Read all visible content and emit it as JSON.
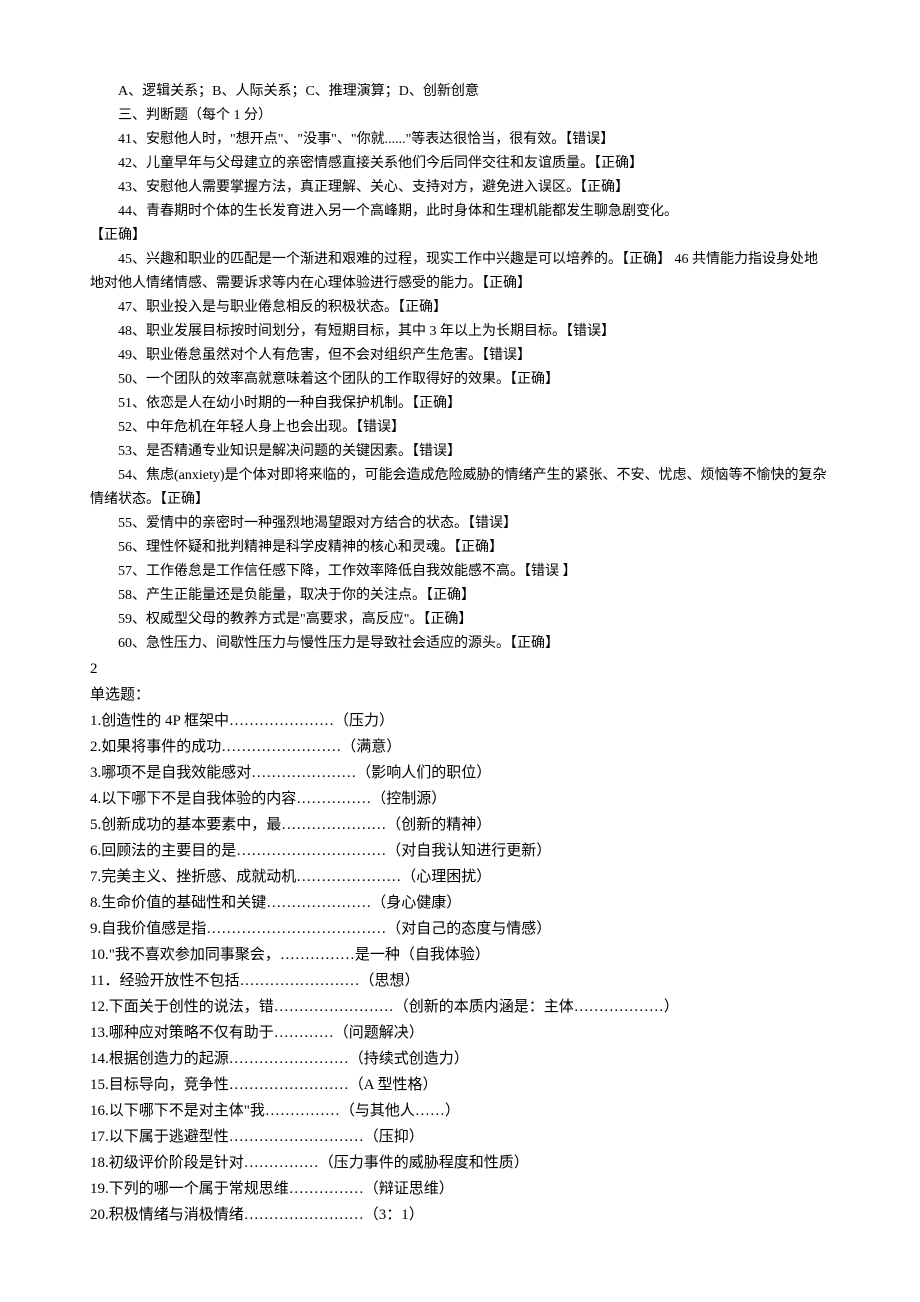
{
  "top": {
    "options": "A、逻辑关系；B、人际关系；C、推理演算；D、创新创意",
    "section_heading": "三、判断题（每个 1 分）",
    "items": [
      "41、安慰他人时，\"想开点\"、\"没事\"、\"你就......\"等表达很恰当，很有效。【错误】",
      "42、儿童早年与父母建立的亲密情感直接关系他们今后同伴交往和友谊质量。【正确】",
      "43、安慰他人需要掌握方法，真正理解、关心、支持对方，避免进入误区。【正确】",
      "44、青春期时个体的生长发育进入另一个高峰期，此时身体和生理机能都发生聊急剧变化。"
    ],
    "item44_tail": "【正确】",
    "item45": "45、兴趣和职业的匹配是一个渐进和艰难的过程，现实工作中兴趣是可以培养的。【正确】  46 共情能力指设身处地地对他人情绪情感、需要诉求等内在心理体验进行感受的能力。【正确】",
    "rest": [
      "47、职业投入是与职业倦怠相反的积极状态。【正确】",
      "48、职业发展目标按时间划分，有短期目标，其中 3 年以上为长期目标。【错误】",
      "49、职业倦怠虽然对个人有危害，但不会对组织产生危害。【错误】",
      "50、一个团队的效率高就意味着这个团队的工作取得好的效果。【正确】",
      "51、依恋是人在幼小时期的一种自我保护机制。【正确】",
      "52、中年危机在年轻人身上也会出现。【错误】",
      "53、是否精通专业知识是解决问题的关键因素。【错误】",
      "54、焦虑(anxiety)是个体对即将来临的，可能会造成危险威胁的情绪产生的紧张、不安、忧虑、烦恼等不愉快的复杂情绪状态。【正确】",
      "55、爱情中的亲密时一种强烈地渴望跟对方结合的状态。【错误】",
      "56、理性怀疑和批判精神是科学皮精神的核心和灵魂。【正确】",
      "57、工作倦怠是工作信任感下降，工作效率降低自我效能感不高。【错误 】",
      "58、产生正能量还是负能量，取决于你的关注点。【正确】",
      "59、权威型父母的教养方式是\"高要求，高反应\"。【正确】",
      "60、急性压力、间歇性压力与慢性压力是导致社会适应的源头。【正确】"
    ]
  },
  "section2": {
    "num": "2",
    "heading": "单选题：",
    "questions": [
      "1.创造性的 4P 框架中…………………（压力）",
      "2.如果将事件的成功……………………（满意）",
      "3.哪项不是自我效能感对…………………（影响人们的职位）",
      "4.以下哪下不是自我体验的内容……………（控制源）",
      "5.创新成功的基本要素中，最…………………（创新的精神）",
      "6.回顾法的主要目的是…………………………（对自我认知进行更新）",
      "7.完美主义、挫折感、成就动机…………………（心理困扰）",
      "8.生命价值的基础性和关键…………………（身心健康）",
      "9.自我价值感是指………………………………（对自己的态度与情感）",
      "10.\"我不喜欢参加同事聚会，……………是一种（自我体验）",
      "11．经验开放性不包括……………………（思想）",
      "12.下面关于创性的说法，错……………………（创新的本质内涵是：主体………………）",
      "13.哪种应对策略不仅有助于…………（问题解决）",
      "14.根据创造力的起源……………………（持续式创造力）",
      "15.目标导向，竞争性……………………（A 型性格）",
      "16.以下哪下不是对主体\"我……………（与其他人……）",
      "17.以下属于逃避型性………………………（压抑）",
      "18.初级评价阶段是针对……………（压力事件的威胁程度和性质）",
      "19.下列的哪一个属于常规思维……………（辩证思维）",
      "20.积极情绪与消极情绪……………………（3：1）"
    ]
  }
}
